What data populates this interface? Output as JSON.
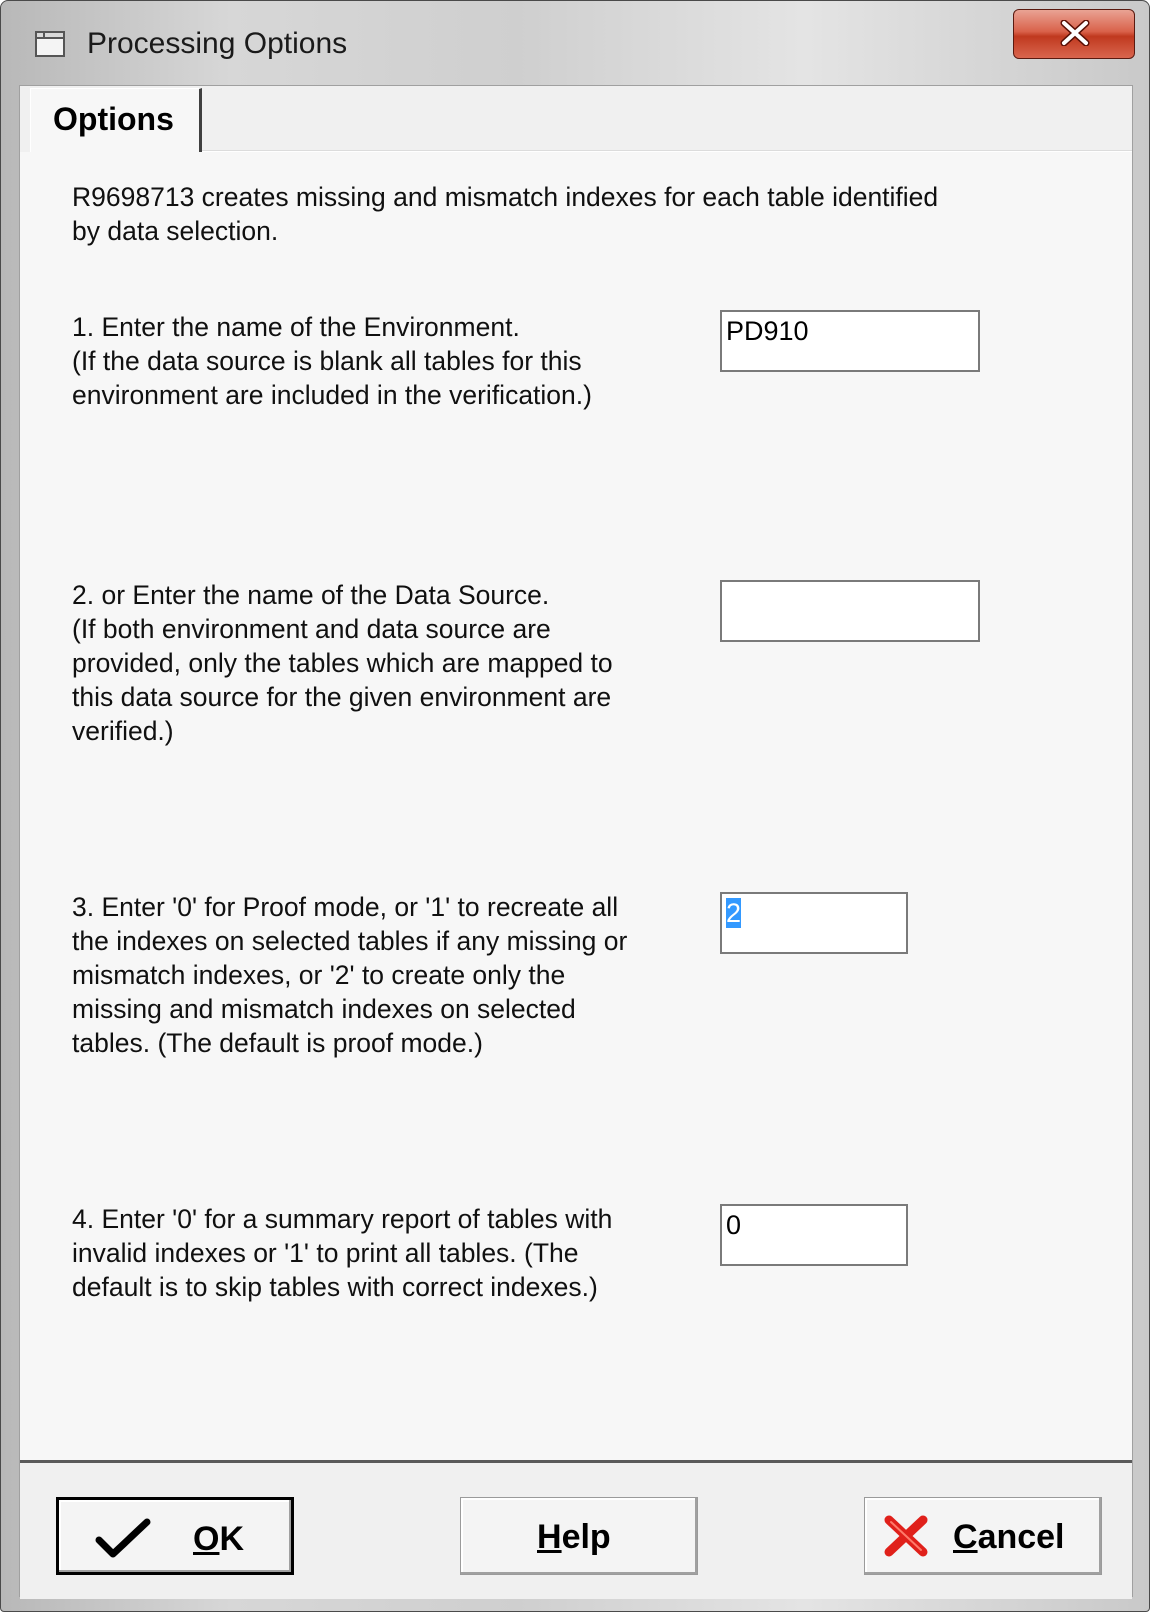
{
  "window": {
    "title": "Processing Options",
    "close_glyph": "✕"
  },
  "tabs": [
    {
      "label": "Options",
      "active": true
    }
  ],
  "intro": "R9698713 creates missing and mismatch indexes for each table identified\nby data selection.",
  "options": [
    {
      "description": "1. Enter the name of the Environment.\n(If the data source is blank all tables for this\nenvironment are included in the verification.)",
      "value": "PD910"
    },
    {
      "description": "2. or Enter the name of the Data Source.\n(If both environment and data source are\nprovided, only the tables which are mapped to\nthis data source for the given environment are\nverified.)",
      "value": ""
    },
    {
      "description": "3. Enter '0' for Proof mode, or '1' to recreate all\nthe indexes on selected tables if any missing or\nmismatch indexes, or '2' to create only the\nmissing and mismatch indexes on selected\ntables. (The default is proof mode.)",
      "value": "2",
      "selected": true
    },
    {
      "description": "4. Enter '0' for a summary report of tables with\ninvalid indexes or '1' to print all tables. (The\ndefault is to skip tables with correct indexes.)",
      "value": "0"
    }
  ],
  "buttons": {
    "ok": {
      "mnemonic": "O",
      "rest": "K",
      "icon": "checkmark-icon"
    },
    "help": {
      "mnemonic": "H",
      "rest": "elp"
    },
    "cancel": {
      "mnemonic": "C",
      "rest": "ancel",
      "icon": "red-x-icon"
    }
  },
  "colors": {
    "selection": "#3399ff",
    "cancel_icon": "#e0201a",
    "close_button": "#c8442c"
  }
}
